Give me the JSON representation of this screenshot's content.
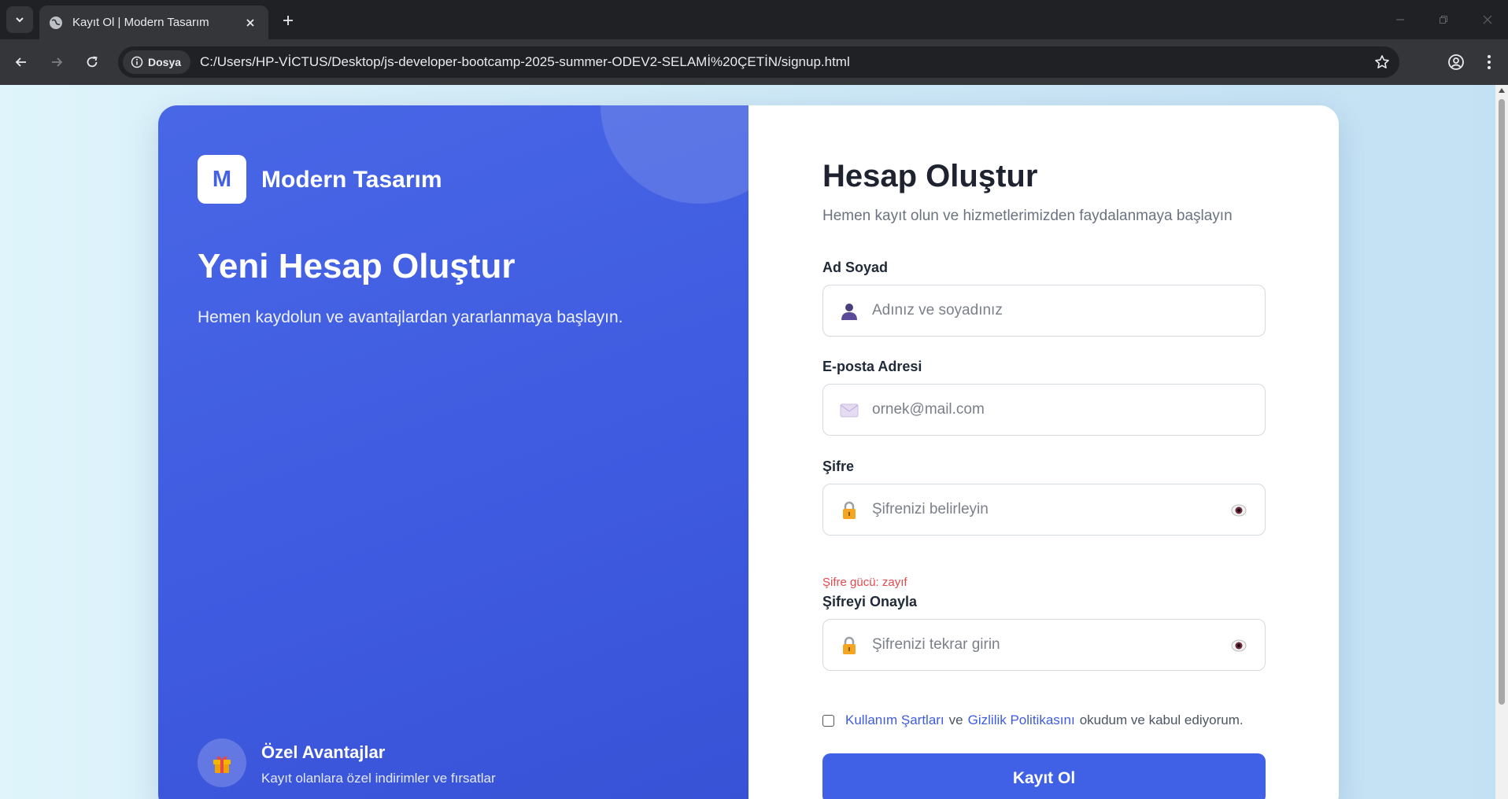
{
  "browser": {
    "tab_title": "Kayıt Ol | Modern Tasarım",
    "site_chip": "Dosya",
    "url": "C:/Users/HP-VİCTUS/Desktop/js-developer-bootcamp-2025-summer-ODEV2-SELAMİ%20ÇETİN/signup.html"
  },
  "left_panel": {
    "logo_letter": "M",
    "brand": "Modern Tasarım",
    "title": "Yeni Hesap Oluştur",
    "subtitle": "Hemen kaydolun ve avantajlardan yararlanmaya başlayın.",
    "perk": {
      "icon": "gift-icon",
      "title": "Özel Avantajlar",
      "description": "Kayıt olanlara özel indirimler ve fırsatlar"
    }
  },
  "form": {
    "title": "Hesap Oluştur",
    "subtitle": "Hemen kayıt olun ve hizmetlerimizden faydalanmaya başlayın",
    "fields": {
      "name": {
        "label": "Ad Soyad",
        "placeholder": "Adınız ve soyadınız",
        "value": "",
        "icon": "user-icon"
      },
      "email": {
        "label": "E-posta Adresi",
        "placeholder": "ornek@mail.com",
        "value": "",
        "icon": "envelope-icon"
      },
      "password": {
        "label": "Şifre",
        "placeholder": "Şifrenizi belirleyin",
        "value": "",
        "icon": "lock-icon"
      },
      "confirm": {
        "label": "Şifreyi Onayla",
        "placeholder": "Şifrenizi tekrar girin",
        "value": "",
        "icon": "lock-icon"
      }
    },
    "strength_text": "Şifre gücü: zayıf",
    "terms": {
      "checked": false,
      "link1": "Kullanım Şartları",
      "and": "ve",
      "link2": "Gizlilik Politikasını",
      "rest": "okudum ve kabul ediyorum."
    },
    "submit_label": "Kayıt Ol"
  },
  "colors": {
    "primary": "#4060e6",
    "panel": "#4363e3",
    "error": "#e5484d"
  }
}
